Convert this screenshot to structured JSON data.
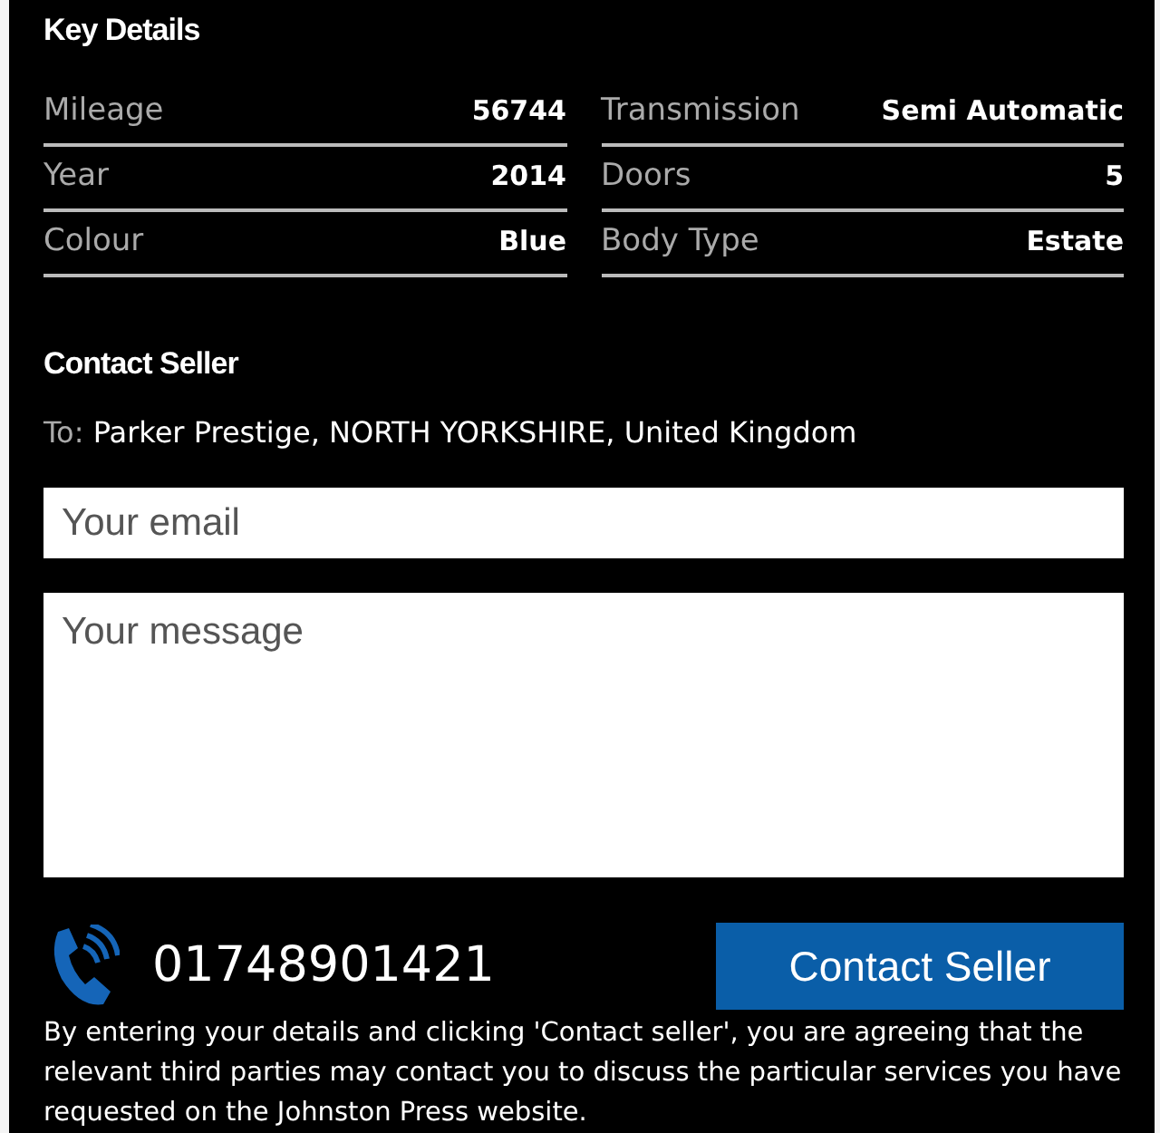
{
  "key_details": {
    "title": "Key Details",
    "left": [
      {
        "label": "Mileage",
        "value": "56744"
      },
      {
        "label": "Year",
        "value": "2014"
      },
      {
        "label": "Colour",
        "value": "Blue"
      }
    ],
    "right": [
      {
        "label": "Transmission",
        "value": "Semi Automatic"
      },
      {
        "label": "Doors",
        "value": "5"
      },
      {
        "label": "Body Type",
        "value": "Estate"
      }
    ]
  },
  "contact": {
    "title": "Contact Seller",
    "to_label": "To:",
    "to_value": "Parker Prestige, NORTH YORKSHIRE, United Kingdom",
    "email": {
      "placeholder": "Your email"
    },
    "message": {
      "placeholder": "Your message"
    },
    "phone": "01748901421",
    "button": "Contact Seller",
    "disclaimer": "By entering your details and clicking 'Contact seller', you are agreeing that the relevant third parties may contact you to discuss the particular services you have requested on the Johnston Press website."
  }
}
